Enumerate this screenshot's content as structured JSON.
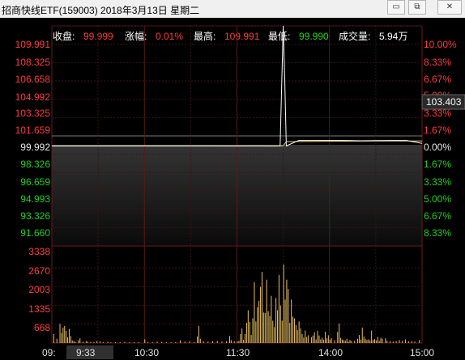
{
  "window": {
    "title": "招商快线ETF(159003)  2018年3月13日  星期二",
    "buttons": {
      "minimize": "▭",
      "restore": "⧉",
      "close": "✕"
    }
  },
  "stats": {
    "close_label": "收盘:",
    "close_value": "99.999",
    "change_label": "涨幅:",
    "change_value": "0.01%",
    "high_label": "最高:",
    "high_value": "109.991",
    "low_label": "最低:",
    "low_value": "99.990",
    "volume_label": "成交量:",
    "volume_value": "5.94万"
  },
  "price_axis_left": {
    "up": [
      "109.991",
      "108.325",
      "106.658",
      "104.992",
      "103.325",
      "101.659"
    ],
    "mid": "99.992",
    "down": [
      "98.326",
      "96.659",
      "94.993",
      "93.326",
      "91.660"
    ]
  },
  "pct_axis_right": {
    "up": [
      "10.00%",
      "8.33%",
      "6.67%",
      "5.00%",
      "3.33%",
      "1.67%"
    ],
    "mid": "0.00%",
    "down": [
      "1.67%",
      "3.33%",
      "5.00%",
      "6.67%",
      "8.33%"
    ]
  },
  "cursor_value": "103.403",
  "volume_axis": [
    "3338",
    "2670",
    "2003",
    "1335",
    "668"
  ],
  "time_axis": [
    "09:",
    "9:33",
    "10:30",
    "11:30",
    "14:00",
    "15:00"
  ],
  "colors": {
    "up": "#ff3b3b",
    "down": "#1fd11f",
    "price_line": "#ffffff",
    "avg_line": "#f0d060",
    "volume_bar": "#e8c060",
    "grid": "#3a1414"
  },
  "chart_data": {
    "type": "line",
    "title": "招商快线ETF(159003)",
    "x_label": "",
    "y_label": "",
    "y_range": [
      91.66,
      109.991
    ],
    "prev_close": 99.992,
    "series": [
      {
        "name": "price",
        "points": [
          [
            0,
            99.995
          ],
          [
            20,
            100.0
          ],
          [
            40,
            99.998
          ],
          [
            60,
            99.996
          ],
          [
            80,
            100.0
          ],
          [
            100,
            99.995
          ],
          [
            118,
            99.993
          ],
          [
            120,
            99.992
          ],
          [
            127,
            99.999
          ],
          [
            134,
            99.996
          ],
          [
            141,
            99.993
          ],
          [
            148,
            99.999
          ],
          [
            150,
            109.991
          ],
          [
            151,
            105.5
          ],
          [
            152,
            99.991
          ],
          [
            153,
            100.05
          ],
          [
            160,
            100.45
          ],
          [
            170,
            100.45
          ],
          [
            180,
            100.45
          ],
          [
            190,
            100.45
          ],
          [
            200,
            100.42
          ],
          [
            210,
            100.44
          ],
          [
            220,
            100.45
          ],
          [
            230,
            100.45
          ],
          [
            240,
            100.2
          ]
        ]
      },
      {
        "name": "average",
        "points": [
          [
            0,
            99.993
          ],
          [
            40,
            99.994
          ],
          [
            80,
            99.994
          ],
          [
            120,
            99.994
          ],
          [
            150,
            99.997
          ],
          [
            152,
            100.35
          ],
          [
            180,
            100.38
          ],
          [
            210,
            100.4
          ],
          [
            240,
            100.4
          ]
        ]
      }
    ],
    "volume": {
      "y_range": [
        0,
        4000
      ],
      "bars": [
        [
          1,
          380
        ],
        [
          3,
          180
        ],
        [
          5,
          820
        ],
        [
          6,
          430
        ],
        [
          7,
          660
        ],
        [
          8,
          730
        ],
        [
          9,
          520
        ],
        [
          10,
          240
        ],
        [
          11,
          600
        ],
        [
          12,
          300
        ],
        [
          13,
          110
        ],
        [
          14,
          90
        ],
        [
          15,
          40
        ],
        [
          17,
          120
        ],
        [
          18,
          200
        ],
        [
          20,
          60
        ],
        [
          22,
          80
        ],
        [
          23,
          60
        ],
        [
          25,
          50
        ],
        [
          27,
          40
        ],
        [
          29,
          90
        ],
        [
          31,
          70
        ],
        [
          33,
          40
        ],
        [
          36,
          50
        ],
        [
          38,
          30
        ],
        [
          41,
          40
        ],
        [
          44,
          30
        ],
        [
          47,
          50
        ],
        [
          50,
          30
        ],
        [
          53,
          40
        ],
        [
          56,
          30
        ],
        [
          60,
          160
        ],
        [
          62,
          40
        ],
        [
          65,
          30
        ],
        [
          68,
          60
        ],
        [
          71,
          50
        ],
        [
          74,
          40
        ],
        [
          77,
          30
        ],
        [
          80,
          40
        ],
        [
          83,
          120
        ],
        [
          86,
          60
        ],
        [
          89,
          70
        ],
        [
          92,
          40
        ],
        [
          94,
          280
        ],
        [
          95,
          720
        ],
        [
          96,
          180
        ],
        [
          98,
          80
        ],
        [
          101,
          60
        ],
        [
          104,
          70
        ],
        [
          107,
          90
        ],
        [
          110,
          60
        ],
        [
          113,
          80
        ],
        [
          115,
          300
        ],
        [
          116,
          120
        ],
        [
          118,
          80
        ],
        [
          120,
          60
        ],
        [
          121,
          90
        ],
        [
          122,
          380
        ],
        [
          123,
          620
        ],
        [
          124,
          140
        ],
        [
          125,
          380
        ],
        [
          126,
          860
        ],
        [
          127,
          1400
        ],
        [
          128,
          900
        ],
        [
          129,
          340
        ],
        [
          130,
          1050
        ],
        [
          131,
          2600
        ],
        [
          132,
          920
        ],
        [
          133,
          1530
        ],
        [
          134,
          1800
        ],
        [
          135,
          2390
        ],
        [
          136,
          3030
        ],
        [
          137,
          1300
        ],
        [
          138,
          1280
        ],
        [
          139,
          2700
        ],
        [
          140,
          1360
        ],
        [
          141,
          1150
        ],
        [
          142,
          2010
        ],
        [
          143,
          950
        ],
        [
          144,
          680
        ],
        [
          145,
          1920
        ],
        [
          146,
          1400
        ],
        [
          147,
          2900
        ],
        [
          148,
          1600
        ],
        [
          149,
          950
        ],
        [
          150,
          3350
        ],
        [
          151,
          1850
        ],
        [
          152,
          2700
        ],
        [
          153,
          2300
        ],
        [
          154,
          860
        ],
        [
          155,
          1850
        ],
        [
          156,
          1120
        ],
        [
          157,
          1050
        ],
        [
          158,
          760
        ],
        [
          159,
          550
        ],
        [
          160,
          920
        ],
        [
          161,
          620
        ],
        [
          162,
          380
        ],
        [
          163,
          230
        ],
        [
          164,
          530
        ],
        [
          165,
          260
        ],
        [
          166,
          330
        ],
        [
          168,
          250
        ],
        [
          169,
          320
        ],
        [
          170,
          460
        ],
        [
          171,
          150
        ],
        [
          172,
          520
        ],
        [
          173,
          320
        ],
        [
          174,
          150
        ],
        [
          175,
          220
        ],
        [
          176,
          140
        ],
        [
          177,
          480
        ],
        [
          178,
          200
        ],
        [
          179,
          330
        ],
        [
          180,
          140
        ],
        [
          181,
          210
        ],
        [
          183,
          120
        ],
        [
          185,
          470
        ],
        [
          186,
          830
        ],
        [
          187,
          220
        ],
        [
          188,
          150
        ],
        [
          189,
          120
        ],
        [
          190,
          100
        ],
        [
          191,
          180
        ],
        [
          192,
          60
        ],
        [
          193,
          130
        ],
        [
          194,
          90
        ],
        [
          196,
          100
        ],
        [
          198,
          180
        ],
        [
          199,
          340
        ],
        [
          200,
          150
        ],
        [
          201,
          660
        ],
        [
          202,
          280
        ],
        [
          203,
          170
        ],
        [
          204,
          130
        ],
        [
          205,
          150
        ],
        [
          206,
          110
        ],
        [
          207,
          530
        ],
        [
          208,
          130
        ],
        [
          209,
          170
        ],
        [
          210,
          110
        ],
        [
          211,
          260
        ],
        [
          212,
          90
        ],
        [
          213,
          220
        ],
        [
          214,
          180
        ],
        [
          216,
          200
        ],
        [
          217,
          90
        ],
        [
          219,
          70
        ],
        [
          221,
          60
        ],
        [
          223,
          80
        ],
        [
          225,
          130
        ],
        [
          227,
          100
        ],
        [
          229,
          150
        ],
        [
          231,
          70
        ],
        [
          233,
          90
        ],
        [
          235,
          60
        ],
        [
          238,
          130
        ]
      ]
    }
  }
}
